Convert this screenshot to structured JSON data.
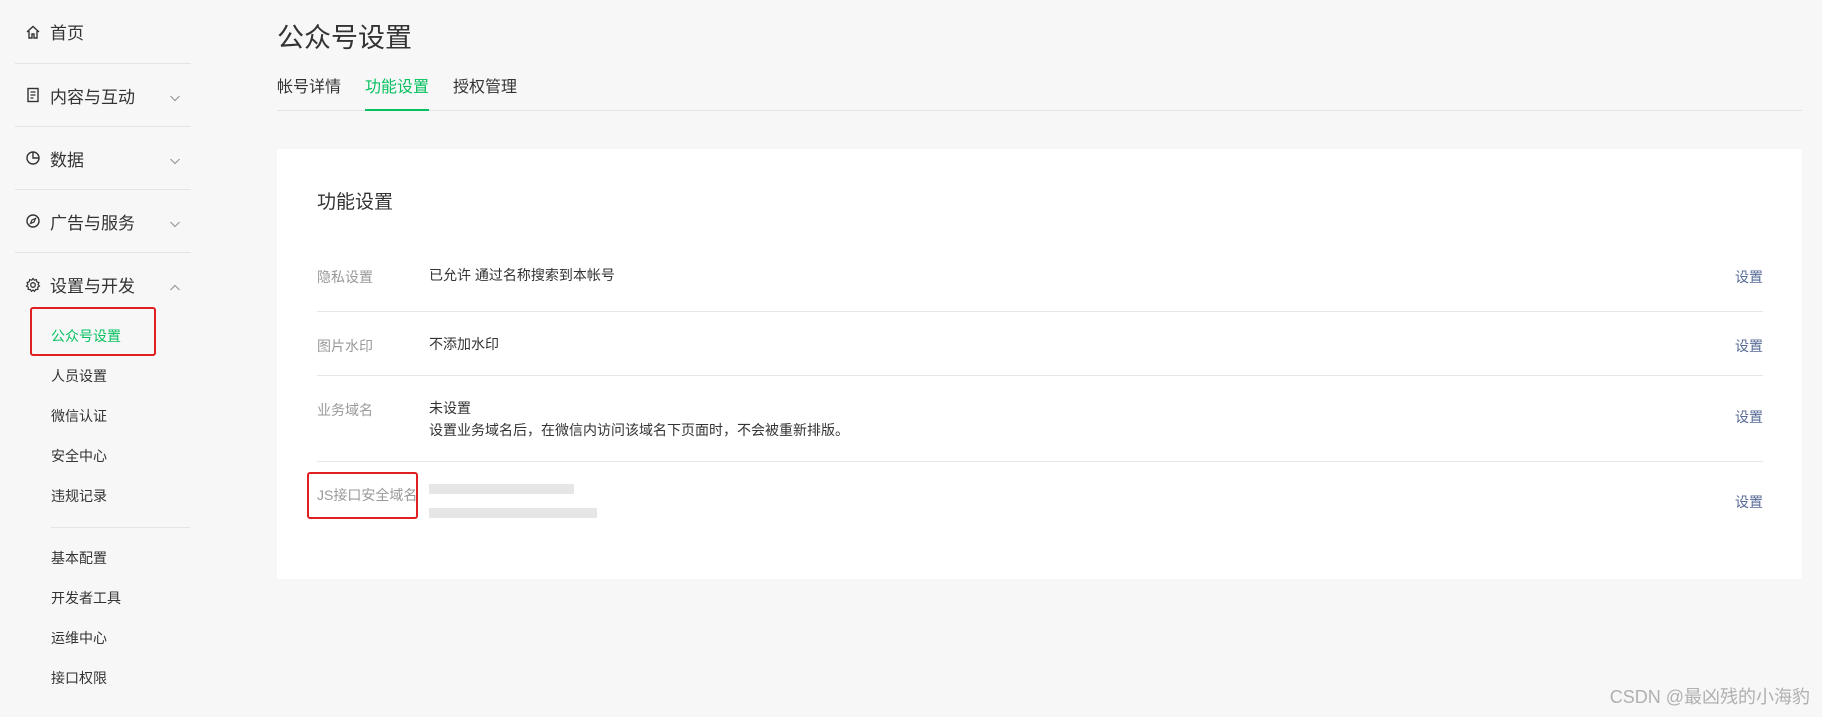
{
  "sidebar": {
    "home": {
      "label": "首页",
      "icon": "home-icon"
    },
    "groups": [
      {
        "label": "内容与互动",
        "icon": "document-icon"
      },
      {
        "label": "数据",
        "icon": "pie-chart-icon"
      },
      {
        "label": "广告与服务",
        "icon": "compass-icon"
      },
      {
        "label": "设置与开发",
        "icon": "gear-icon"
      }
    ],
    "sub_items": [
      {
        "label": "公众号设置",
        "active": true
      },
      {
        "label": "人员设置"
      },
      {
        "label": "微信认证"
      },
      {
        "label": "安全中心"
      },
      {
        "label": "违规记录"
      }
    ],
    "sub_items_2": [
      {
        "label": "基本配置"
      },
      {
        "label": "开发者工具"
      },
      {
        "label": "运维中心"
      },
      {
        "label": "接口权限"
      }
    ]
  },
  "main": {
    "title": "公众号设置",
    "tabs": [
      {
        "label": "帐号详情"
      },
      {
        "label": "功能设置",
        "active": true
      },
      {
        "label": "授权管理"
      }
    ],
    "card": {
      "title": "功能设置",
      "rows": [
        {
          "label": "隐私设置",
          "value": "已允许 通过名称搜索到本帐号",
          "action": "设置"
        },
        {
          "label": "图片水印",
          "value": "不添加水印",
          "action": "设置"
        },
        {
          "label": "业务域名",
          "value": "未设置",
          "value2": "设置业务域名后，在微信内访问该域名下页面时，不会被重新排版。",
          "action": "设置"
        },
        {
          "label": "JS接口安全域名",
          "action": "设置"
        }
      ]
    }
  },
  "watermark": "CSDN @最凶残的小海豹",
  "colors": {
    "accent": "#07c160",
    "link": "#576b95",
    "highlight": "#e02020"
  }
}
